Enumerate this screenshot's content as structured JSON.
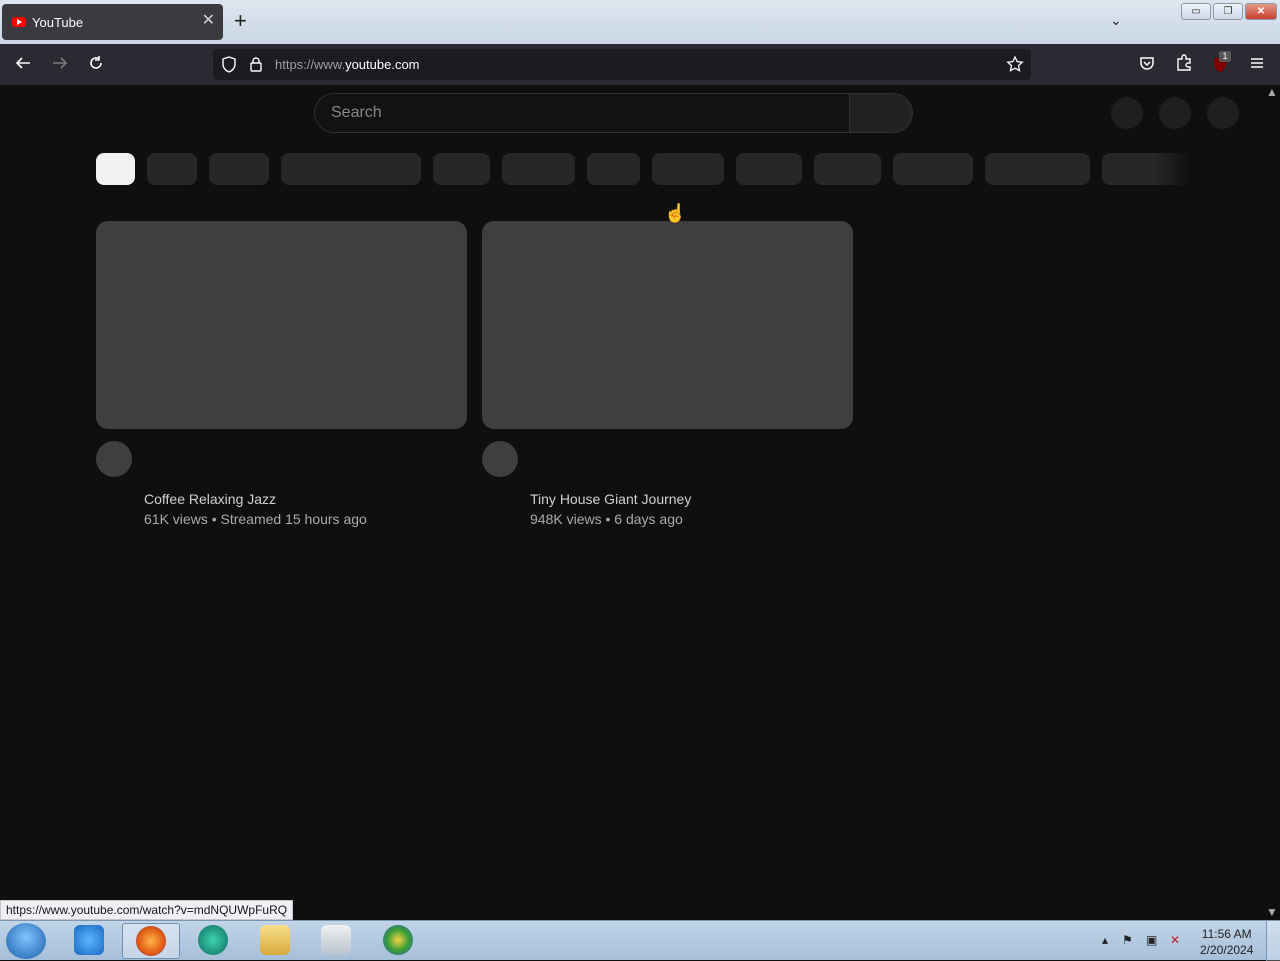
{
  "browser": {
    "tab_title": "YouTube",
    "tab_close": "✕",
    "new_tab": "+",
    "tab_list": "⌄",
    "url_prefix": "https://www.",
    "url_domain": "youtube.com",
    "ublock_badge": "1",
    "window_buttons": {
      "minimize": "▭",
      "restore": "❐",
      "close": "✕"
    }
  },
  "youtube": {
    "search_placeholder": "Search",
    "videos": [
      {
        "title": "Coffee Relaxing Jazz",
        "meta": "61K views • Streamed 15 hours ago"
      },
      {
        "title": "Tiny House Giant Journey",
        "meta": "948K views • 6 days ago"
      }
    ]
  },
  "status_url": "https://www.youtube.com/watch?v=mdNQUWpFuRQ",
  "taskbar": {
    "time": "11:56 AM",
    "date": "2/20/2024"
  },
  "icons": {
    "back": "back-arrow-icon",
    "forward": "forward-arrow-icon",
    "reload": "reload-icon",
    "shield": "tracking-shield-icon",
    "lock": "lock-icon",
    "bookmark": "star-icon",
    "pocket": "pocket-icon",
    "extensions": "puzzle-icon",
    "menu": "hamburger-icon"
  }
}
